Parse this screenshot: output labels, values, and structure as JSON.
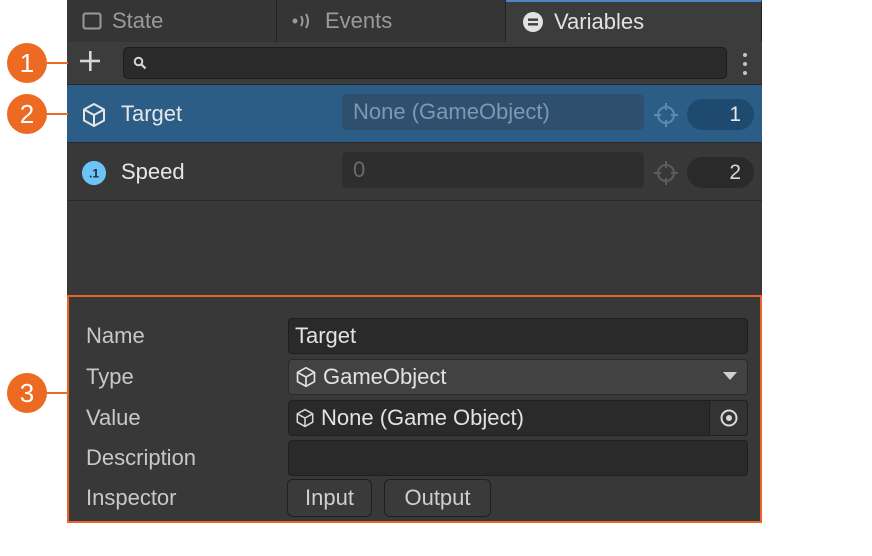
{
  "tabs": [
    {
      "label": "State",
      "icon": "square-icon",
      "active": false
    },
    {
      "label": "Events",
      "icon": "broadcast-icon",
      "active": false
    },
    {
      "label": "Variables",
      "icon": "variables-icon",
      "active": true
    }
  ],
  "toolbar": {
    "add_icon": "plus-icon",
    "search_placeholder": "",
    "menu_icon": "kebab-icon"
  },
  "variables": [
    {
      "name": "Target",
      "icon": "cube-icon",
      "value": "None (GameObject)",
      "order": "1",
      "selected": true
    },
    {
      "name": "Speed",
      "icon": "float-icon",
      "icon_text": ".1",
      "value": "0",
      "order": "2",
      "selected": false
    }
  ],
  "inspector": {
    "name_label": "Name",
    "name_value": "Target",
    "type_label": "Type",
    "type_value": "GameObject",
    "value_label": "Value",
    "value_value": "None (Game Object)",
    "description_label": "Description",
    "description_value": "",
    "inspector_label": "Inspector",
    "input_button": "Input",
    "output_button": "Output"
  },
  "callouts": [
    "1",
    "2",
    "3"
  ],
  "colors": {
    "accent": "#ec6a22",
    "selection": "#2c5d87",
    "panel": "#383838",
    "float_badge": "#6bc4f5"
  }
}
